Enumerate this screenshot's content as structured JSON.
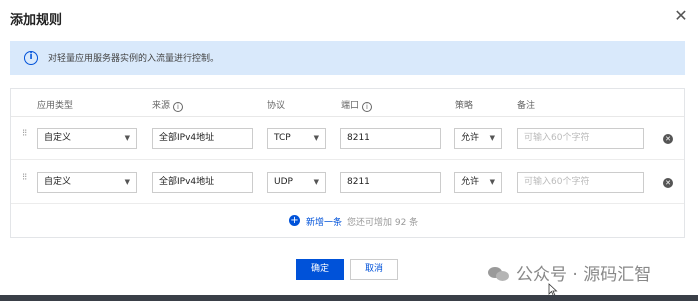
{
  "dialog": {
    "title": "添加规则",
    "close_icon": "close-icon"
  },
  "notice": {
    "icon": "info-icon",
    "text": "对轻量应用服务器实例的入流量进行控制。"
  },
  "table": {
    "headers": {
      "app_type": "应用类型",
      "source": "来源",
      "protocol": "协议",
      "port": "端口",
      "policy": "策略",
      "remark": "备注"
    },
    "rows": [
      {
        "app_type": "自定义",
        "source": "全部IPv4地址",
        "protocol": "TCP",
        "port": "8211",
        "policy": "允许",
        "remark_placeholder": "可输入60个字符"
      },
      {
        "app_type": "自定义",
        "source": "全部IPv4地址",
        "protocol": "UDP",
        "port": "8211",
        "policy": "允许",
        "remark_placeholder": "可输入60个字符"
      }
    ],
    "add_row": {
      "link": "新增一条",
      "hint": "您还可增加 92 条"
    }
  },
  "footer": {
    "confirm": "确定",
    "cancel": "取消"
  },
  "watermark": {
    "text": "公众号 · 源码汇智"
  },
  "colors": {
    "primary": "#0052d9",
    "notice_bg": "#d9e9fb"
  }
}
